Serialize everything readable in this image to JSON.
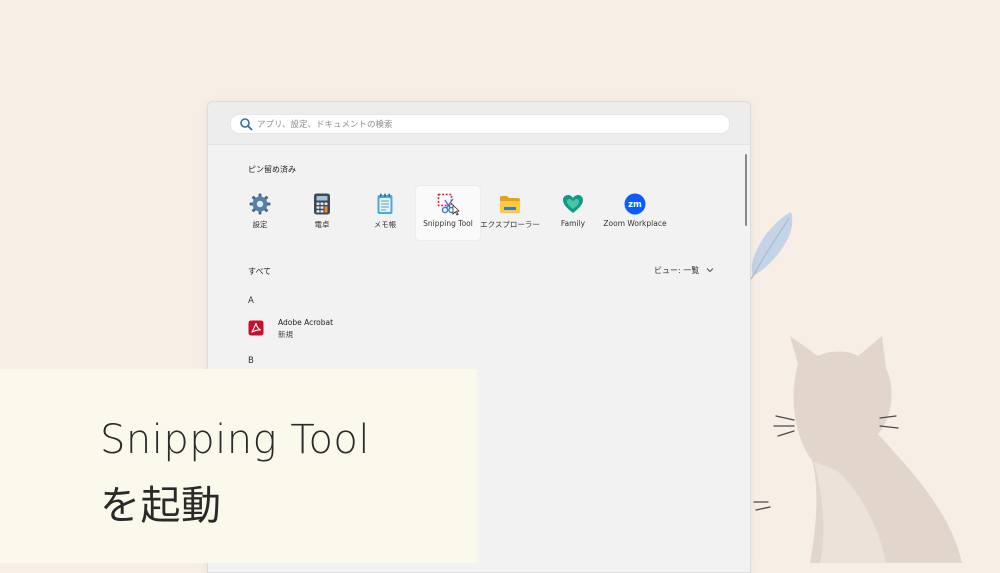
{
  "search": {
    "placeholder": "アプリ、設定、ドキュメントの検索"
  },
  "pinned": {
    "title": "ピン留め済み",
    "items": [
      {
        "label": "設定",
        "icon": "gear-icon"
      },
      {
        "label": "電卓",
        "icon": "calculator-icon"
      },
      {
        "label": "メモ帳",
        "icon": "notepad-icon"
      },
      {
        "label": "Snipping Tool",
        "icon": "snipping-tool-icon"
      },
      {
        "label": "エクスプローラー",
        "icon": "folder-icon"
      },
      {
        "label": "Family",
        "icon": "family-heart-icon"
      },
      {
        "label": "Zoom Workplace",
        "icon": "zoom-icon"
      }
    ]
  },
  "all_apps": {
    "title": "すべて",
    "view_label": "ビュー: 一覧",
    "groups": [
      {
        "letter": "A",
        "apps": [
          {
            "name": "Adobe Acrobat",
            "badge": "新規",
            "icon": "acrobat-icon"
          }
        ]
      },
      {
        "letter": "B",
        "apps": []
      }
    ]
  },
  "caption": {
    "line1": "Snipping Tool",
    "line2": "を起動"
  },
  "colors": {
    "background": "#f7eee6",
    "caption_bg": "#fbf9ec",
    "panel_bg": "#f2f2f2",
    "acrobat_red": "#c8102e",
    "zoom_blue": "#0b5cff",
    "family_teal": "#0e9b8a"
  }
}
